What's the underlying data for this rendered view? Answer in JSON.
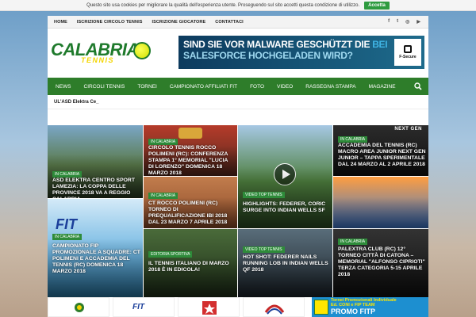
{
  "cookie": {
    "message": "Questo sito usa cookies per migliorare la qualità dell'esperienza utente. Proseguendo sul sito accetti questa condizione di utilizzo.",
    "accept_label": "Accetta"
  },
  "topbar": {
    "links": [
      "HOME",
      "ISCRIZIONE CIRCOLO TENNIS",
      "ISCRIZIONE GIOCATORE",
      "CONTATTACI"
    ],
    "social_icons": [
      "facebook-icon",
      "twitter-icon",
      "instagram-icon",
      "youtube-icon"
    ],
    "social_glyphs": [
      "f",
      "t",
      "◎",
      "▶"
    ]
  },
  "logo": {
    "main": "CALABRIA",
    "sub": "TENNIS"
  },
  "ad": {
    "line1_a": "SIND SIE VOR MALWARE GESCHÜTZT DIE ",
    "line1_b": "BEI",
    "line2": "SALESFORCE HOCHGELADEN WIRD?",
    "brand": "F-Secure"
  },
  "nav": {
    "items": [
      "NEWS",
      "CIRCOLI TENNIS",
      "TORNEI",
      "CAMPIONATO AFFILIATI FIT",
      "FOTO",
      "VIDEO",
      "RASSEGNA STAMPA",
      "MAGAZINE"
    ]
  },
  "ticker": {
    "text": "UL'ASD Elektra Ce_"
  },
  "tiles": [
    {
      "category": "IN CALABRIA",
      "title": "ASD ELEKTRA CENTRO SPORT LAMEZIA: LA COPPA DELLE PROVINCE 2018 VA A REGGIO CALABRIA"
    },
    {
      "category": "IN CALABRIA",
      "title": "CIRCOLO TENNIS ROCCO POLIMENI (RC): CONFERENZA STAMPA 1° MEMORIAL \"LUCIA DI LORENZO\" DOMENICA 18 MARZO 2018"
    },
    {
      "category": "VIDEO TOP TENNIS",
      "title": "HIGHLIGHTS: FEDERER, CORIC SURGE INTO INDIAN WELLS SF",
      "side_tag": "VIDEO TOP TENNIS"
    },
    {
      "category": "IN CALABRIA",
      "title": "ACCADEMIA DEL TENNIS (RC) MACRO AREA JUNIOR NEXT GEN JUNIOR – TAPPA SPERIMENTALE DAL 24 MARZO AL 2 APRILE 2018",
      "badge": "NEXT GEN"
    },
    {
      "category": "IN CALABRIA",
      "title": "CT ROCCO POLIMENI (RC) TORNEO DI PREQUALIFICAZIONE IBI 2018 DAL 23 MARZO 7 APRILE 2018"
    },
    {
      "category": "IN CALABRIA",
      "title": "CAMPIONATO FIP PROMOZIONALE A SQUADRE: CT POLIMENI E ACCADEMIA DEL TENNIS (RC) DOMENICA 18 MARZO 2018",
      "badge": "FIT"
    },
    {
      "category": "EDITORIA SPORTIVA",
      "title": "IL TENNIS ITALIANO DI MARZO 2018 È IN EDICOLA!"
    },
    {
      "category": "VIDEO TOP TENNIS",
      "title": "HOT SHOT: FEDERER NAILS RUNNING LOB IN INDIAN WELLS QF 2018"
    },
    {
      "category": "IN CALABRIA",
      "title": "PALEXTRA CLUB (RC) 12° TORNEO CITTÀ DI CATONA – MEMORIAL \"ALFONSO CIPRIOTI\" TERZA CATEGORIA 5-15 APRILE 2018"
    }
  ],
  "banners": {
    "fit": "FIT",
    "promo_line1": "Tornei Promozionali Individuale",
    "promo_line2": "Ed. CONI e FIP TEAM",
    "promo_big": "PROMO FITP"
  },
  "colors": {
    "nav_green": "#2e7d2a",
    "category_green": "#2e8b3a",
    "accept_green": "#2e9b3f",
    "logo_yellow": "#f3d500"
  }
}
